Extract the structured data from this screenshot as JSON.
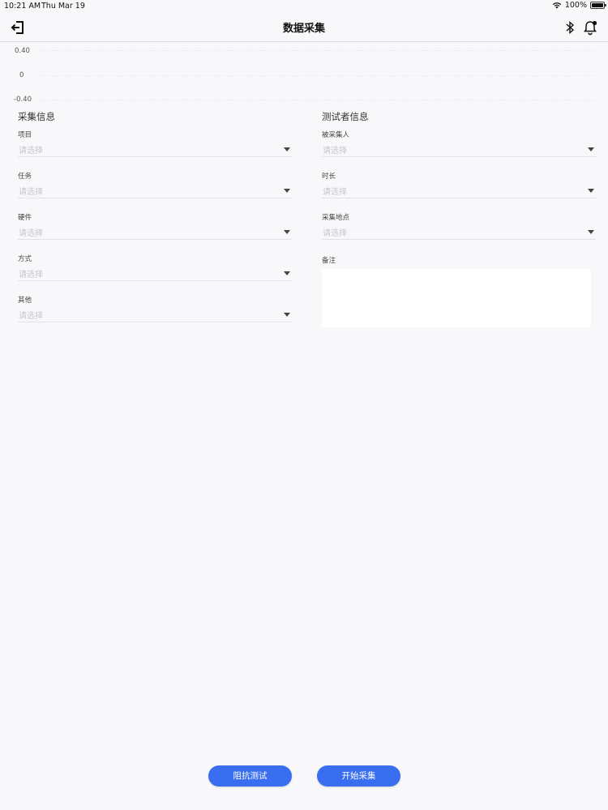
{
  "status_bar": {
    "time": "10:21 AM",
    "date": "Thu Mar 19",
    "battery": "100%"
  },
  "nav": {
    "title": "数据采集",
    "left_icon": "exit-icon",
    "right_icons": [
      "bluetooth-icon",
      "bell-icon"
    ]
  },
  "chart": {
    "ticks": [
      "0.40",
      "0",
      "-0.40"
    ]
  },
  "collection_info": {
    "title": "采集信息",
    "fields": [
      {
        "label": "项目",
        "placeholder": "请选择"
      },
      {
        "label": "任务",
        "placeholder": "请选择"
      },
      {
        "label": "硬件",
        "placeholder": "请选择"
      },
      {
        "label": "方式",
        "placeholder": "请选择"
      },
      {
        "label": "其他",
        "placeholder": "请选择"
      }
    ]
  },
  "tester_info": {
    "title": "测试者信息",
    "fields": [
      {
        "label": "被采集人",
        "placeholder": "请选择"
      },
      {
        "label": "时长",
        "placeholder": "请选择"
      },
      {
        "label": "采集地点",
        "placeholder": "请选择"
      }
    ],
    "remark_label": "备注",
    "remark_value": ""
  },
  "buttons": {
    "impedance_test": "阻抗测试",
    "start_collection": "开始采集"
  },
  "colors": {
    "accent": "#3a6ef0",
    "background": "#f8f8fa"
  }
}
